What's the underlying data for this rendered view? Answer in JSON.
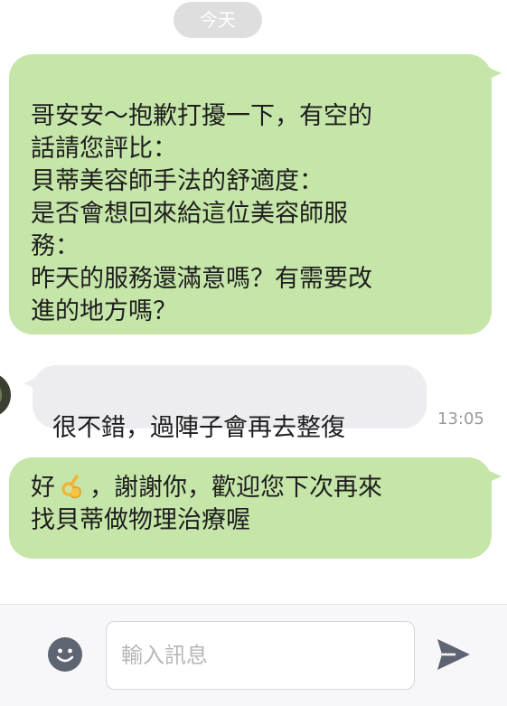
{
  "conversation": {
    "date_label": "今天",
    "messages": [
      {
        "direction": "outgoing",
        "text": "哥安安～抱歉打擾一下，有空的\n話請您評比：\n貝蒂美容師手法的舒適度：\n是否會想回來給這位美容師服\n務：\n昨天的服務還滿意嗎？有需要改\n進的地方嗎？"
      },
      {
        "direction": "incoming",
        "text": "很不錯，過陣子會再去整復",
        "time": "13:05"
      },
      {
        "direction": "outgoing",
        "text_before_emoji": "好",
        "emoji": "ok-hand-emoji",
        "text_after_emoji": "，謝謝你，歡迎您下次再來\n找貝蒂做物理治療喔"
      }
    ]
  },
  "composer": {
    "placeholder": "輸入訊息",
    "value": "",
    "emoji_icon": "smiley-icon",
    "send_icon": "send-icon"
  },
  "colors": {
    "outgoing_bubble": "#c6e6a9",
    "incoming_bubble": "#ededf1",
    "icon": "#5f6472"
  }
}
